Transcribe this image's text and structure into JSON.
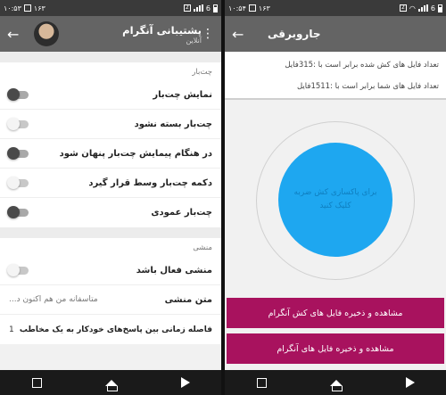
{
  "colors": {
    "accent": "#a8125e",
    "circle": "#1ea7f0",
    "appbar": "#646464",
    "statusbar": "#3a3a3a"
  },
  "left": {
    "status": {
      "time": "۱۰:۵۳",
      "sim": "2",
      "battery": "6",
      "notif": "۱۶۳"
    },
    "header": {
      "title": "پشتیبانی آنگرام",
      "subtitle": "آنلاین"
    },
    "sections": [
      {
        "title": "چت‌بار",
        "items": [
          {
            "label": "نمایش چت‌بار",
            "state": "off-dark"
          },
          {
            "label": "چت‌بار بسته نشود",
            "state": "off-light"
          },
          {
            "label": "در هنگام پیمایش چت‌بار پنهان شود",
            "state": "off-dark"
          },
          {
            "label": "دکمه چت‌بار وسط قرار گیرد",
            "state": "off-light"
          },
          {
            "label": "چت‌بار عمودی",
            "state": "off-dark"
          }
        ]
      },
      {
        "title": "منشی",
        "items": [
          {
            "label": "منشی فعال باشد",
            "state": "off-light"
          }
        ]
      }
    ],
    "secretary_text": {
      "label": "متن منشی",
      "value": "متاسفانه من هم اکنون د..."
    },
    "interval": {
      "label": "فاصله زمانی بین پاسخ‌های خودکار به یک مخاطب",
      "value": "1"
    }
  },
  "right": {
    "status": {
      "time": "۱۰:۵۴",
      "sim": "2",
      "battery": "6",
      "notif": "۱۶۳"
    },
    "header": {
      "title": "جاروبرقی"
    },
    "info_line1": "تعداد فایل های کش شده برابر است با :315فایل",
    "info_line2": "تعداد فایل های شما برابر است با :1511فایل",
    "circle_text": "برای پاکسازی کش ضربه کلیک کنید",
    "button1": "مشاهده و ذخیره فایل های کش آنگرام",
    "button2": "مشاهده و ذخیره فایل های آنگرام"
  },
  "icons": {
    "back": "arrow-left-icon",
    "menu": "kebab-menu-icon",
    "recents": "square-icon",
    "home": "home-icon",
    "back_nav": "triangle-back-icon"
  }
}
